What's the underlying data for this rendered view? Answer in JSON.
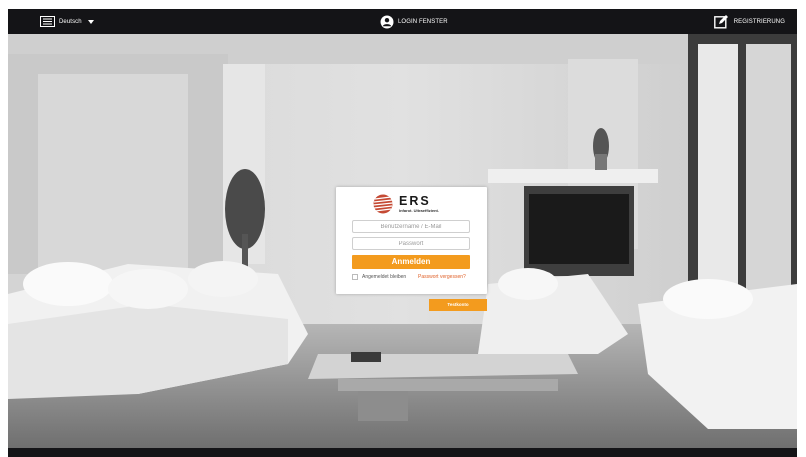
{
  "topbar": {
    "language": "Deutsch",
    "center_title": "LOGIN FENSTER",
    "register": "REGISTRIERUNG"
  },
  "login": {
    "logo_name": "ERS",
    "logo_tagline": "Infarot. Ultraeffizient.",
    "username_placeholder": "Benutzername / E-Mail",
    "password_placeholder": "Passwort",
    "login_button": "Anmelden",
    "remember_label": "Angemeldet bleiben",
    "forgot_link": "Passwort vergessen?",
    "test_button": "Testkonto"
  },
  "colors": {
    "accent": "#f39b1e",
    "topbar": "#141417",
    "link": "#e0622a"
  },
  "icons": [
    "language-icon",
    "user-icon",
    "edit-icon",
    "ers-logo-icon"
  ]
}
